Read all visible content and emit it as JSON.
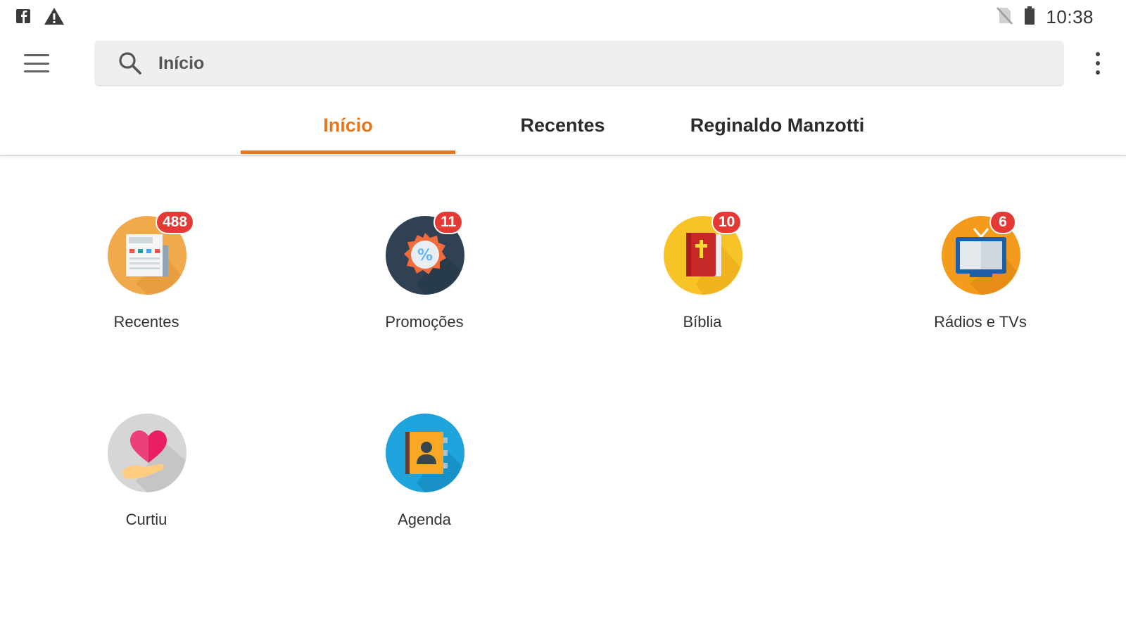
{
  "status_bar": {
    "left_icons": [
      "facebook-icon",
      "warning-icon"
    ],
    "right_icons": [
      "no-sim-icon",
      "battery-icon"
    ],
    "time": "10:38"
  },
  "toolbar": {
    "menu_icon": "hamburger-menu-icon",
    "search_icon": "search-icon",
    "search_text": "Início",
    "overflow_icon": "more-vert-icon"
  },
  "tabs": [
    {
      "label": "Início",
      "active": true
    },
    {
      "label": "Recentes",
      "active": false
    },
    {
      "label": "Reginaldo Manzotti",
      "active": false
    }
  ],
  "accent_color": "#e8751a",
  "badge_color": "#e53935",
  "tiles": [
    {
      "label": "Recentes",
      "badge": "488",
      "icon": "newspaper-icon"
    },
    {
      "label": "Promoções",
      "badge": "11",
      "icon": "discount-badge-icon"
    },
    {
      "label": "Bíblia",
      "badge": "10",
      "icon": "bible-icon"
    },
    {
      "label": "Rádios e TVs",
      "badge": "6",
      "icon": "tv-icon"
    },
    {
      "label": "Curtiu",
      "badge": "",
      "icon": "heart-hand-icon"
    },
    {
      "label": "Agenda",
      "badge": "",
      "icon": "contacts-book-icon"
    }
  ]
}
